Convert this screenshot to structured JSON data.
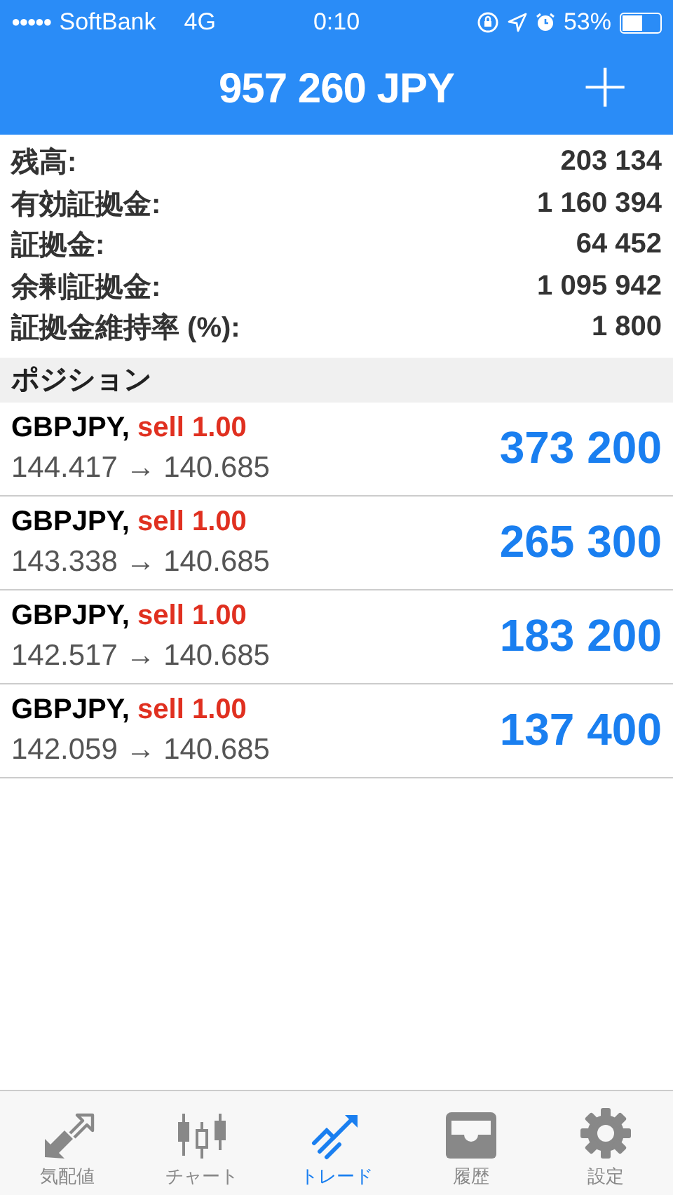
{
  "status_bar": {
    "signal_dots": "●●●●●",
    "carrier": "SoftBank",
    "network": "4G",
    "time": "0:10",
    "battery": "53%"
  },
  "header": {
    "title": "957 260 JPY",
    "add": "+"
  },
  "summary": [
    {
      "label": "残高:",
      "value": "203 134"
    },
    {
      "label": "有効証拠金:",
      "value": "1 160 394"
    },
    {
      "label": "証拠金:",
      "value": "64 452"
    },
    {
      "label": "余剰証拠金:",
      "value": "1 095 942"
    },
    {
      "label": "証拠金維持率 (%):",
      "value": "1 800"
    }
  ],
  "positions_header": "ポジション",
  "positions": [
    {
      "symbol": "GBPJPY,",
      "side": "sell 1.00",
      "prices": "144.417 → 140.685",
      "profit": "373 200"
    },
    {
      "symbol": "GBPJPY,",
      "side": "sell 1.00",
      "prices": "143.338 → 140.685",
      "profit": "265 300"
    },
    {
      "symbol": "GBPJPY,",
      "side": "sell 1.00",
      "prices": "142.517 → 140.685",
      "profit": "183 200"
    },
    {
      "symbol": "GBPJPY,",
      "side": "sell 1.00",
      "prices": "142.059 → 140.685",
      "profit": "137 400"
    }
  ],
  "tabs": [
    {
      "kind": "quotes",
      "label": "気配値",
      "selected": false
    },
    {
      "kind": "chart",
      "label": "チャート",
      "selected": false
    },
    {
      "kind": "trade",
      "label": "トレード",
      "selected": true
    },
    {
      "kind": "history",
      "label": "履歴",
      "selected": false
    },
    {
      "kind": "settings",
      "label": "設定",
      "selected": false
    }
  ]
}
